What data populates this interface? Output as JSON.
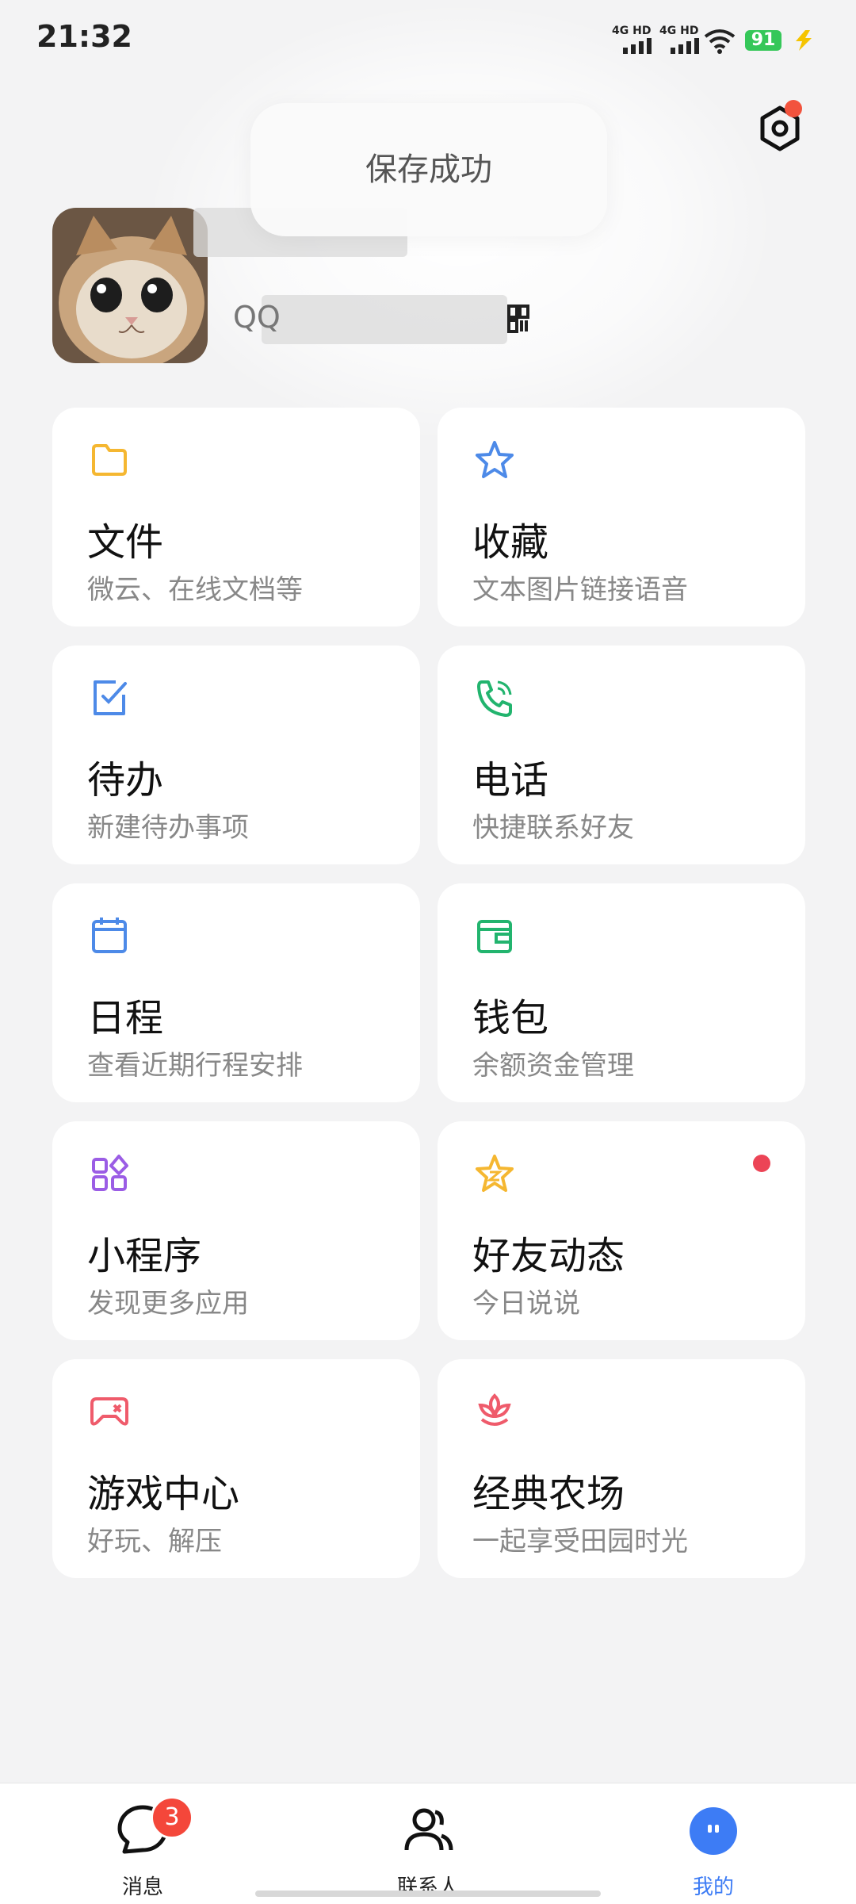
{
  "status_bar": {
    "time": "21:32",
    "network_1": "4G HD",
    "network_2": "4G HD",
    "battery": "91"
  },
  "toast": {
    "text": "保存成功"
  },
  "profile": {
    "qq_prefix": "QQ"
  },
  "cards": [
    {
      "title": "文件",
      "subtitle": "微云、在线文档等",
      "icon": "folder-icon",
      "color": "#f5b731"
    },
    {
      "title": "收藏",
      "subtitle": "文本图片链接语音",
      "icon": "star-icon",
      "color": "#4d8ae8"
    },
    {
      "title": "待办",
      "subtitle": "新建待办事项",
      "icon": "todo-icon",
      "color": "#4d8ae8"
    },
    {
      "title": "电话",
      "subtitle": "快捷联系好友",
      "icon": "phone-icon",
      "color": "#22b46e"
    },
    {
      "title": "日程",
      "subtitle": "查看近期行程安排",
      "icon": "calendar-icon",
      "color": "#4d8ae8"
    },
    {
      "title": "钱包",
      "subtitle": "余额资金管理",
      "icon": "wallet-icon",
      "color": "#22b46e"
    },
    {
      "title": "小程序",
      "subtitle": "发现更多应用",
      "icon": "mini-program-icon",
      "color": "#9b5de5"
    },
    {
      "title": "好友动态",
      "subtitle": "今日说说",
      "icon": "friend-feed-star-icon",
      "color": "#f5b731"
    },
    {
      "title": "游戏中心",
      "subtitle": "好玩、解压",
      "icon": "gamepad-icon",
      "color": "#ef5b6b"
    },
    {
      "title": "经典农场",
      "subtitle": "一起享受田园时光",
      "icon": "farm-plant-icon",
      "color": "#ef5b6b"
    }
  ],
  "nav": {
    "messages": {
      "label": "消息",
      "badge": "3"
    },
    "contacts": {
      "label": "联系人"
    },
    "me": {
      "label": "我的"
    }
  },
  "colors": {
    "accent": "#3d7cf5",
    "badge_red": "#f4473a"
  }
}
